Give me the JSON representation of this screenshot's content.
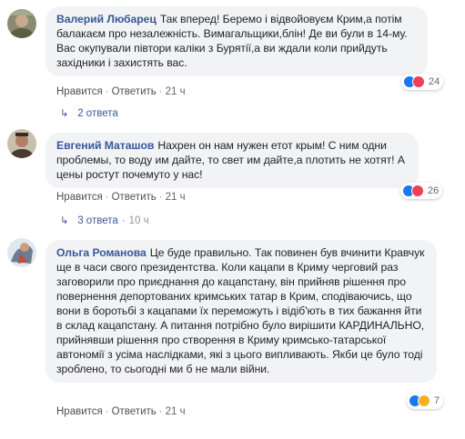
{
  "comments": [
    {
      "author": "Валерий Любарец",
      "text": "Так вперед! Беремо і вiдвойовуєм Крим,а потім балакаєм про незалежність. Вимагальщики,блін! Де ви були в 14-му. Вас окупували півтори каліки з Бурятії,а ви ждали коли прийдуть західники і захистять вас.",
      "like": "Нравится",
      "reply": "Ответить",
      "time": "21 ч",
      "reactions": "24",
      "replies": "2 ответа",
      "replies_time": ""
    },
    {
      "author": "Евгений Маташов",
      "text": "Нахрен он нам нужен етот крым! С ним одни проблемы, то воду им дайте, то свет им дайте,а плотить не хотят! А цены ростут почемуто у нас!",
      "like": "Нравится",
      "reply": "Ответить",
      "time": "21 ч",
      "reactions": "26",
      "replies": "3 ответа",
      "replies_time": "10 ч"
    },
    {
      "author": "Ольга Романова",
      "text": "Це буде правильно. Так повинен був вчинити Кравчук ще в часи свого президентства. Коли кацапи в Криму черговий раз заговорили про приєднання до кацапстану, він прийняв рішення про повернення депортованих кримських татар в Крим, сподіваючись, що вони в боротьбі з кацапами їх переможуть і відіб'ють в тих бажання йти в склад кацапстану. А питання потрібно було вирішити КАРДИНАЛЬНО, прийнявши рішення про створення в Криму кримсько-татарської автономії з усіма наслідками, які з цього випливають. Якби це було тоді зроблено, то сьогодні ми б не мали війни.",
      "like": "Нравится",
      "reply": "Ответить",
      "time": "21 ч",
      "reactions": "7",
      "replies": "",
      "replies_time": ""
    }
  ],
  "colors": {
    "author": "#385898",
    "bubble": "#f2f3f5",
    "like_blue": "#1877f2",
    "love_red": "#f33e58",
    "haha_yellow": "#f7b125"
  }
}
